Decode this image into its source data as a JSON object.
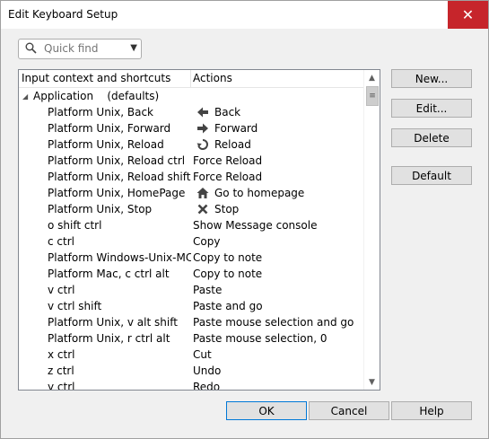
{
  "window": {
    "title": "Edit Keyboard Setup",
    "close_symbol": "✕"
  },
  "search": {
    "placeholder": "Quick find",
    "value": ""
  },
  "tree": {
    "columns": [
      "Input context and shortcuts",
      "Actions"
    ],
    "group": {
      "label": "Application",
      "note": "(defaults)"
    },
    "rows": [
      {
        "shortcut": "Platform Unix, Back",
        "action": "Back",
        "icon": "back-arrow-icon"
      },
      {
        "shortcut": "Platform Unix, Forward",
        "action": "Forward",
        "icon": "forward-arrow-icon"
      },
      {
        "shortcut": "Platform Unix, Reload",
        "action": "Reload",
        "icon": "reload-icon"
      },
      {
        "shortcut": "Platform Unix, Reload ctrl",
        "action": "Force Reload"
      },
      {
        "shortcut": "Platform Unix, Reload shift",
        "action": "Force Reload"
      },
      {
        "shortcut": "Platform Unix, HomePage",
        "action": "Go to homepage",
        "icon": "home-icon"
      },
      {
        "shortcut": "Platform Unix, Stop",
        "action": "Stop",
        "icon": "stop-x-icon"
      },
      {
        "shortcut": "o shift ctrl",
        "action": "Show Message console"
      },
      {
        "shortcut": "c ctrl",
        "action": "Copy"
      },
      {
        "shortcut": "Platform Windows-Unix-MC...",
        "action": "Copy to note"
      },
      {
        "shortcut": "Platform Mac, c ctrl alt",
        "action": "Copy to note"
      },
      {
        "shortcut": "v ctrl",
        "action": "Paste"
      },
      {
        "shortcut": "v ctrl shift",
        "action": "Paste and go"
      },
      {
        "shortcut": "Platform Unix, v alt shift",
        "action": "Paste mouse selection and go"
      },
      {
        "shortcut": "Platform Unix, r ctrl alt",
        "action": "Paste mouse selection, 0"
      },
      {
        "shortcut": "x ctrl",
        "action": "Cut"
      },
      {
        "shortcut": "z ctrl",
        "action": "Undo"
      },
      {
        "shortcut": "y ctrl",
        "action": "Redo"
      }
    ]
  },
  "side_buttons": {
    "new": "New...",
    "edit": "Edit...",
    "delete": "Delete",
    "default": "Default"
  },
  "footer": {
    "ok": "OK",
    "cancel": "Cancel",
    "help": "Help"
  },
  "colors": {
    "close": "#c6252b",
    "accent_border": "#0078d7"
  }
}
